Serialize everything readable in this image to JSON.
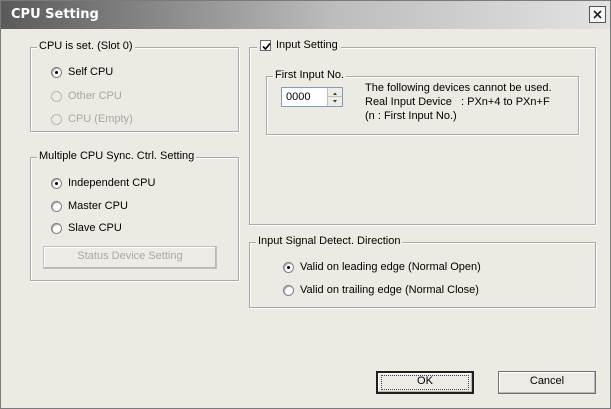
{
  "window": {
    "title": "CPU Setting"
  },
  "cpu_set": {
    "legend": "CPU is set. (Slot 0)",
    "options": [
      {
        "label": "Self CPU",
        "selected": true,
        "enabled": true
      },
      {
        "label": "Other CPU",
        "selected": false,
        "enabled": false
      },
      {
        "label": "CPU (Empty)",
        "selected": false,
        "enabled": false
      }
    ]
  },
  "sync": {
    "legend": "Multiple CPU Sync. Ctrl. Setting",
    "options": [
      {
        "label": "Independent CPU",
        "selected": true
      },
      {
        "label": "Master CPU",
        "selected": false
      },
      {
        "label": "Slave CPU",
        "selected": false
      }
    ],
    "status_button": "Status Device Setting"
  },
  "input_setting": {
    "label": "Input Setting",
    "checked": true,
    "first_input": {
      "legend": "First Input No.",
      "value": "0000",
      "note_line1": "The following devices cannot be used.",
      "note_line2": "Real Input Device   : PXn+4 to PXn+F",
      "note_line3": "(n : First Input No.)"
    }
  },
  "detect": {
    "legend": "Input Signal Detect. Direction",
    "options": [
      {
        "label": "Valid on leading edge (Normal Open)",
        "selected": true
      },
      {
        "label": "Valid on trailing edge (Normal Close)",
        "selected": false
      }
    ]
  },
  "buttons": {
    "ok": "OK",
    "cancel": "Cancel"
  }
}
